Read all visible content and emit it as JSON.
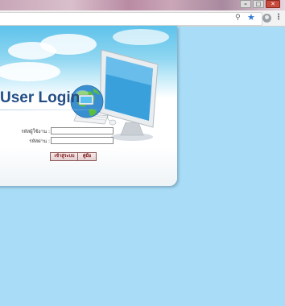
{
  "browser": {
    "window_buttons": {
      "minimize": "–",
      "maximize": "□",
      "close": "✕"
    },
    "toolbar_icons": [
      "key-icon",
      "star-icon",
      "profile-icon",
      "menu-icon"
    ],
    "accent_color": "#2f7bd8"
  },
  "page": {
    "background_color": "#a9ddf7",
    "title": "User Login",
    "title_color": "#234e86",
    "form": {
      "username_label": "รหัสผู้ใช้งาน :",
      "password_label": "รหัสผ่าน :",
      "username_value": "",
      "password_value": ""
    },
    "buttons": {
      "login": "เข้าสู่ระบบ",
      "manual": "คู่มือ"
    }
  }
}
